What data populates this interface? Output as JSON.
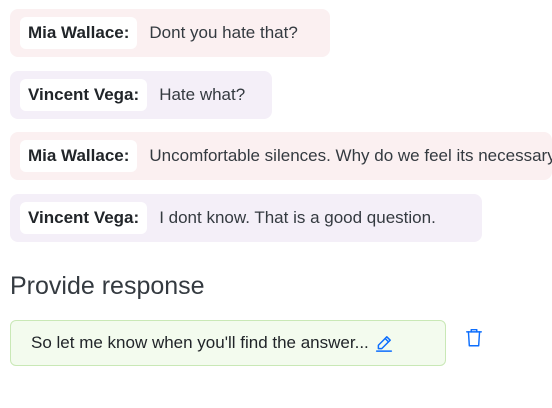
{
  "conversation": [
    {
      "speaker": "Mia Wallace:",
      "text": "Dont you hate that?",
      "role": "mia"
    },
    {
      "speaker": "Vincent Vega:",
      "text": "Hate what?",
      "role": "vincent"
    },
    {
      "speaker": "Mia Wallace:",
      "text": "Uncomfortable silences. Why do we feel its necessary to yak about bullshit in order to be comfortable?",
      "role": "mia"
    },
    {
      "speaker": "Vincent Vega:",
      "text": "I dont know. That is a good question.",
      "role": "vincent"
    }
  ],
  "response_section": {
    "title": "Provide response",
    "response_text": "So let me know when you'll find the answer...",
    "edit_icon": "pencil-icon",
    "delete_icon": "trash-icon"
  },
  "colors": {
    "mia_bg": "#fbf0f1",
    "vincent_bg": "#f4eff8",
    "response_bg": "#f3fbee",
    "response_border": "#c9e8b6",
    "icon_blue": "#0d6efd"
  }
}
